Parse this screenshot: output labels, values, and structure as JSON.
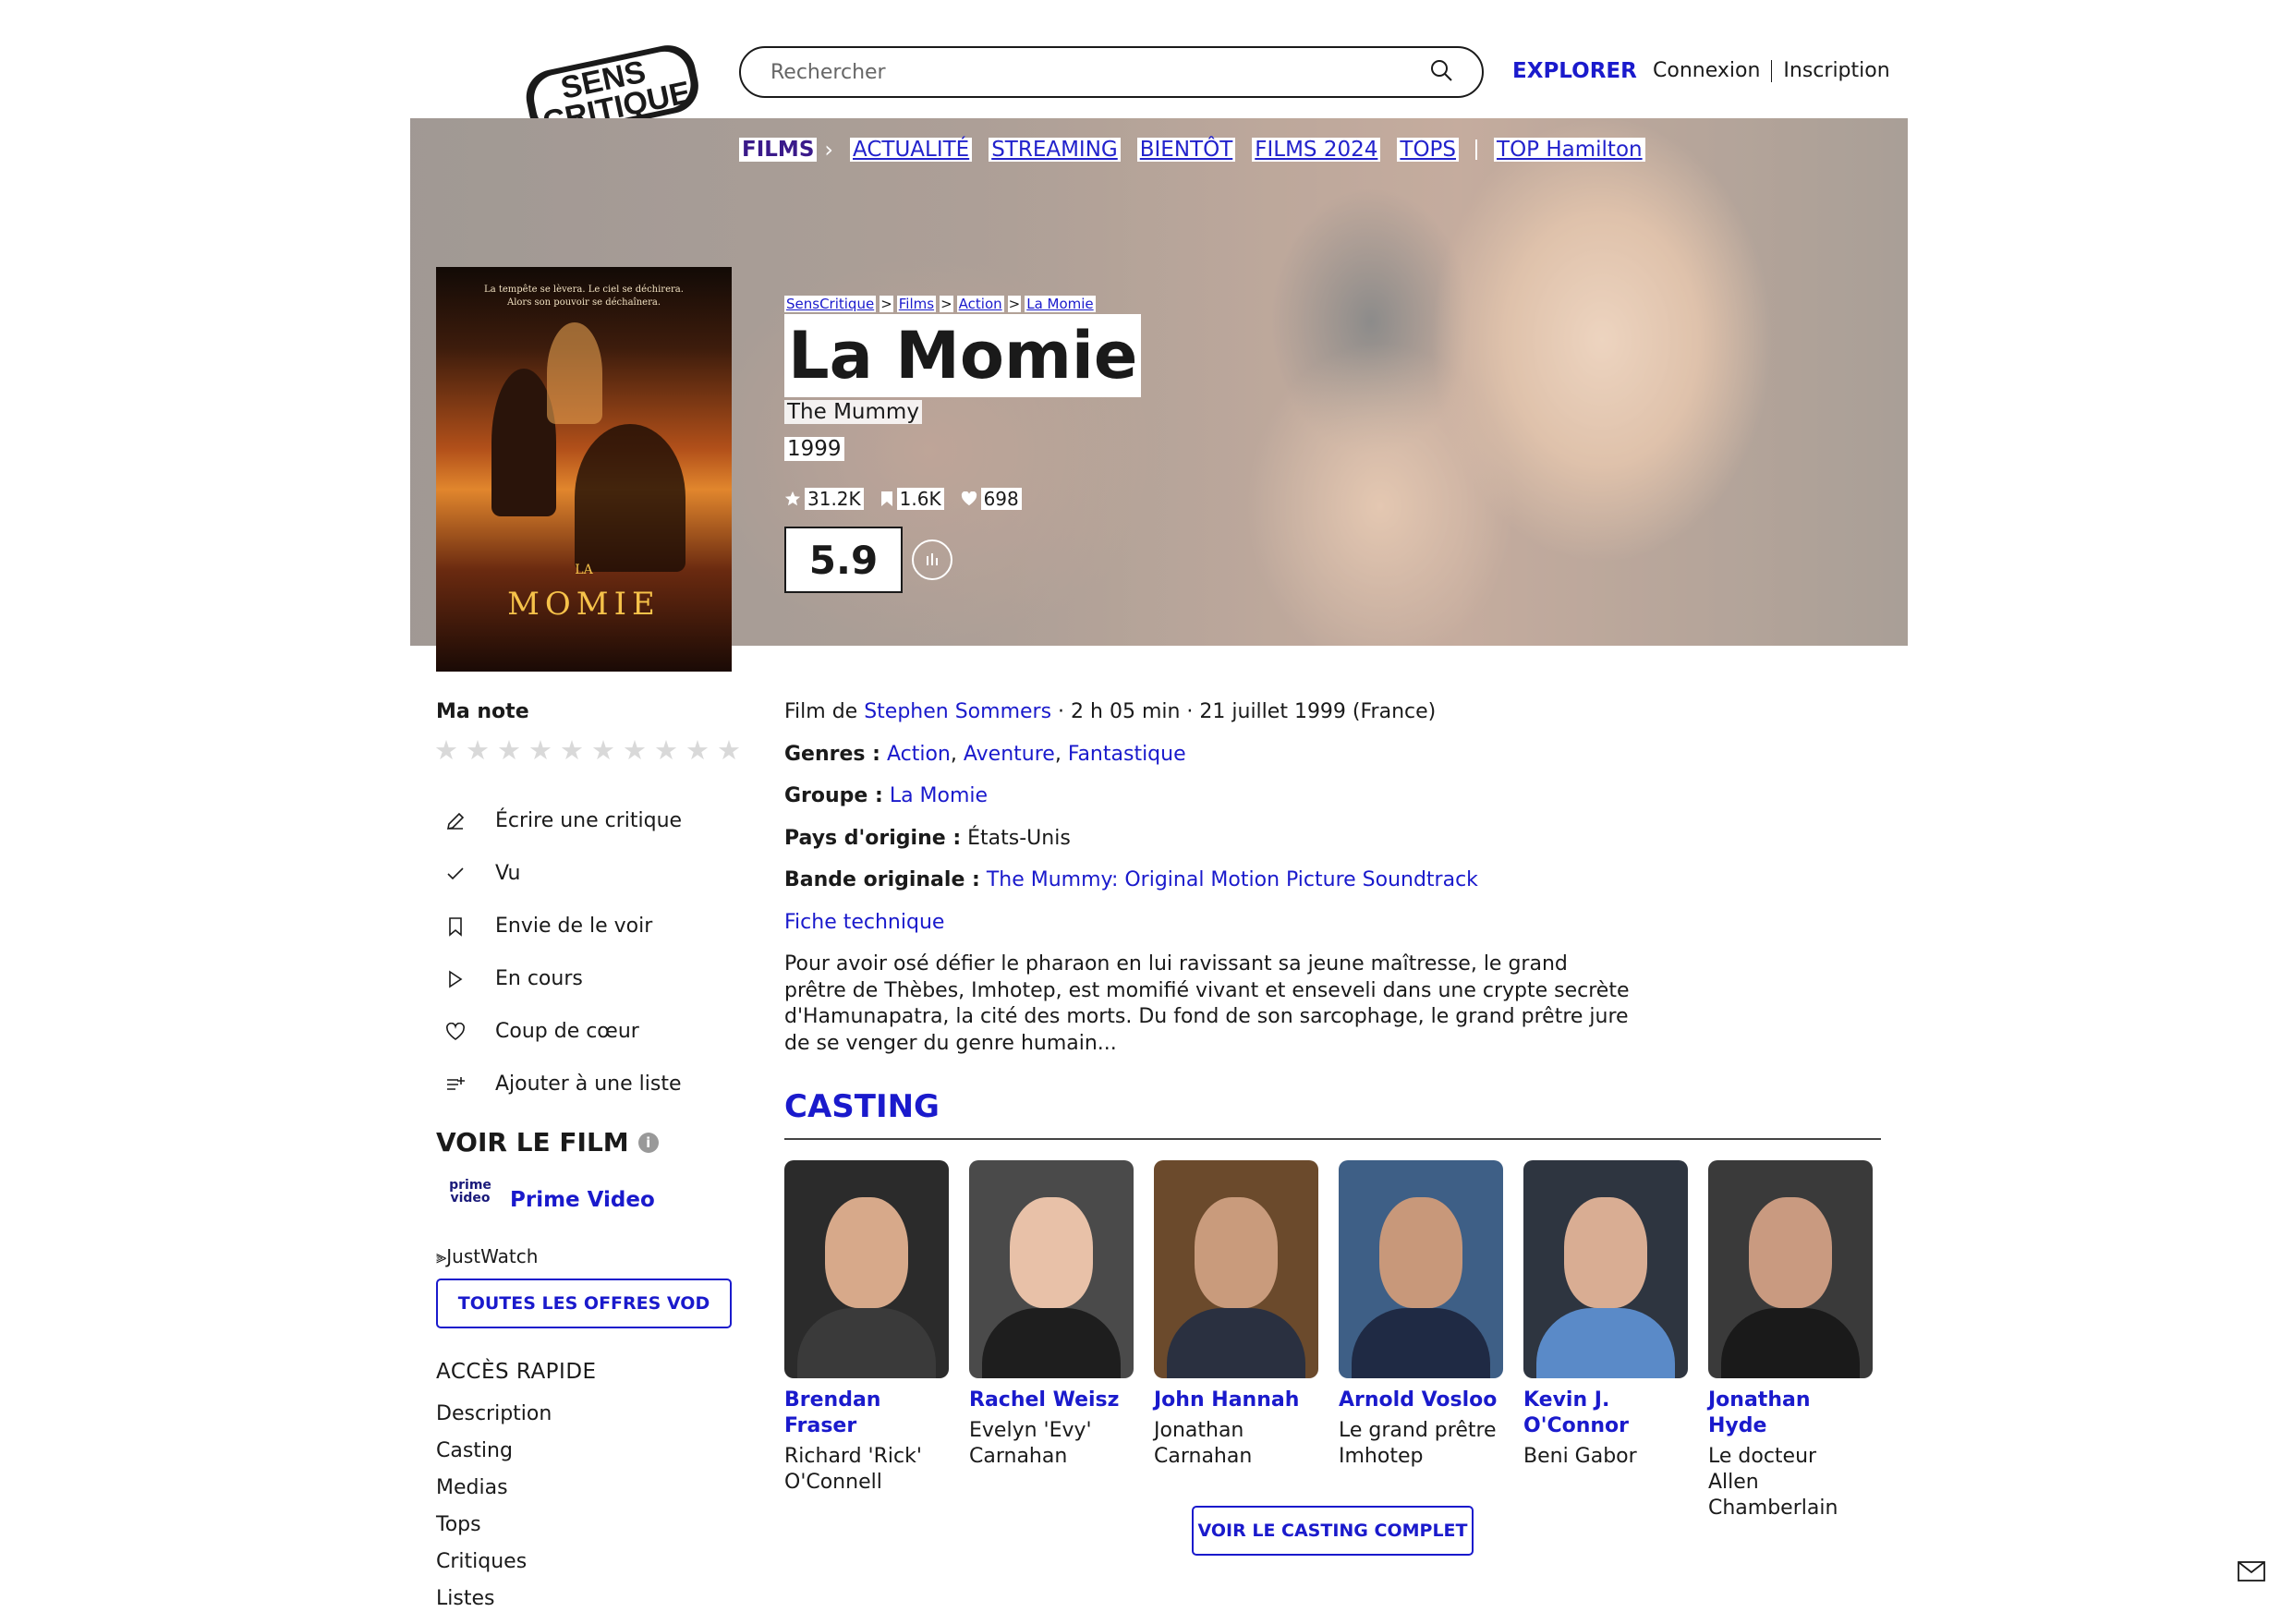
{
  "header": {
    "logo_text": "SENS CRITIQUE",
    "search_placeholder": "Rechercher",
    "explore_label": "EXPLORER",
    "login_label": "Connexion",
    "signup_label": "Inscription"
  },
  "nav": {
    "items": [
      "FILMS",
      "ACTUALITÉ",
      "STREAMING",
      "BIENTÔT",
      "FILMS 2024",
      "TOPS",
      "TOP Hamilton"
    ]
  },
  "poster": {
    "tagline_1": "La tempête se lèvera. Le ciel se déchirera.",
    "tagline_2": "Alors son pouvoir se déchaînera.",
    "title_small": "LA",
    "title_big": "MOMIE"
  },
  "movie": {
    "breadcrumbs": [
      "SensCritique",
      "Films",
      "Action",
      "La Momie"
    ],
    "title": "La Momie",
    "original_title": "The Mummy",
    "year": "1999",
    "stats": {
      "ratings": "31.2K",
      "wishes": "1.6K",
      "favorites": "698"
    },
    "score": "5.9",
    "director_prefix": "Film de",
    "director": "Stephen Sommers",
    "details": " · 2 h 05 min · 21 juillet 1999 (France)",
    "genres_label": "Genres :",
    "genres": [
      "Action",
      "Aventure",
      "Fantastique"
    ],
    "group_label": "Groupe :",
    "group": "La Momie",
    "country_label": "Pays d'origine :",
    "country": "États-Unis",
    "soundtrack_label": "Bande originale :",
    "soundtrack": "The Mummy: Original Motion Picture Soundtrack",
    "tech_sheet": "Fiche technique",
    "synopsis": "Pour avoir osé défier le pharaon en lui ravissant sa jeune maîtresse, le grand prêtre de Thèbes, Imhotep, est momifié vivant et enseveli dans une crypte secrète d'Hamunapatra, la cité des morts. Du fond de son sarcophage, le grand prêtre jure de se venger du genre humain..."
  },
  "sidebar": {
    "my_rating_label": "Ma note",
    "actions": [
      "Écrire une critique",
      "Vu",
      "Envie de le voir",
      "En cours",
      "Coup de cœur",
      "Ajouter à une liste"
    ],
    "watch_title": "VOIR LE FILM",
    "provider_logo": "prime video",
    "provider": "Prime Video",
    "justwatch": "JustWatch",
    "vod_button": "TOUTES LES OFFRES VOD",
    "quick_title": "ACCÈS RAPIDE",
    "quick_links": [
      "Description",
      "Casting",
      "Medias",
      "Tops",
      "Critiques",
      "Listes"
    ]
  },
  "casting": {
    "title": "CASTING",
    "members": [
      {
        "name": "Brendan Fraser",
        "role": "Richard 'Rick' O'Connell",
        "bg": "#2b2b2b",
        "skin": "#d7a98a",
        "cloth": "#3a3a3a"
      },
      {
        "name": "Rachel Weisz",
        "role": "Evelyn 'Evy' Carnahan",
        "bg": "#4a4a4a",
        "skin": "#e8c1a8",
        "cloth": "#1e1e1e"
      },
      {
        "name": "John Hannah",
        "role": "Jonathan Carnahan",
        "bg": "#6b4a2c",
        "skin": "#c99b7c",
        "cloth": "#2a3040"
      },
      {
        "name": "Arnold Vosloo",
        "role": "Le grand prêtre Imhotep",
        "bg": "#3e5f86",
        "skin": "#c8987a",
        "cloth": "#1f2a44"
      },
      {
        "name": "Kevin J. O'Connor",
        "role": "Beni Gabor",
        "bg": "#2e3540",
        "skin": "#d9ad93",
        "cloth": "#5a8ac8"
      },
      {
        "name": "Jonathan Hyde",
        "role": "Le docteur Allen Chamberlain",
        "bg": "#3a3a3a",
        "skin": "#c99a80",
        "cloth": "#1a1a1a"
      }
    ],
    "full_button": "VOIR LE CASTING COMPLET"
  }
}
